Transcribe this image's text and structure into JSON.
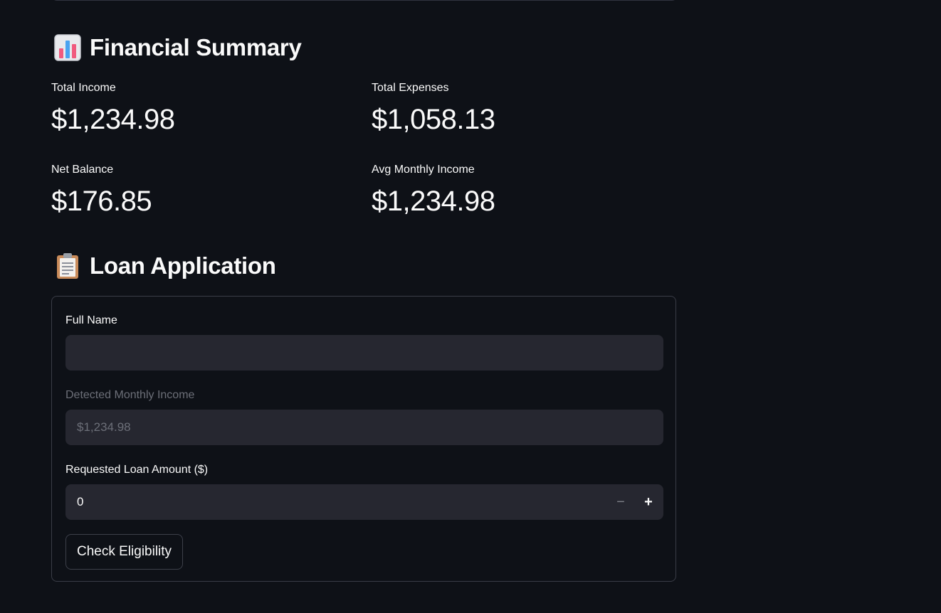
{
  "financial_summary": {
    "title": "Financial Summary",
    "icon": "bar-chart-icon",
    "metrics": {
      "total_income": {
        "label": "Total Income",
        "value": "$1,234.98"
      },
      "total_expenses": {
        "label": "Total Expenses",
        "value": "$1,058.13"
      },
      "net_balance": {
        "label": "Net Balance",
        "value": "$176.85"
      },
      "avg_monthly_income": {
        "label": "Avg Monthly Income",
        "value": "$1,234.98"
      }
    }
  },
  "loan_application": {
    "title": "Loan Application",
    "icon": "clipboard-icon",
    "full_name": {
      "label": "Full Name",
      "value": ""
    },
    "detected_income": {
      "label": "Detected Monthly Income",
      "value": "$1,234.98"
    },
    "loan_amount": {
      "label": "Requested Loan Amount ($)",
      "value": "0",
      "minus": "−",
      "plus": "+"
    },
    "submit_label": "Check Eligibility"
  },
  "colors": {
    "background": "#0e1117",
    "input_bg": "#262730",
    "text": "#fafafa",
    "muted": "#6c6f78"
  }
}
